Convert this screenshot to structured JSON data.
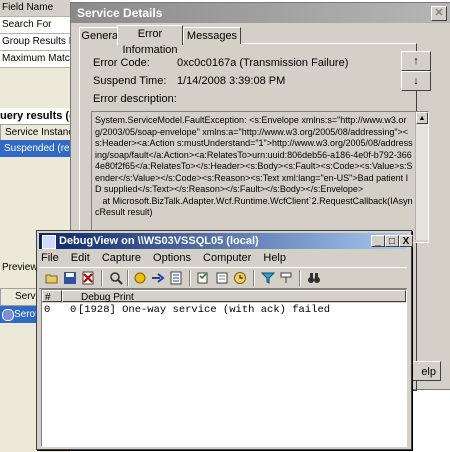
{
  "background_window": {
    "filter_grid": {
      "header": "Field Name",
      "rows": [
        "Search For",
        "Group Results By",
        "Maximum Matches"
      ]
    },
    "query_results_title": "uery results (one",
    "column_header": "Service Instance",
    "selected_row": "Suspended (resum",
    "preview_label": "Preview fo",
    "column_header_2": "Servic",
    "row_2": "Serote"
  },
  "service_details": {
    "title": "Service Details",
    "close_label": "✕",
    "tabs": [
      "General",
      "Error Information",
      "Messages"
    ],
    "active_tab": "Error Information",
    "fields": {
      "error_code_label": "Error Code:",
      "error_code_value": "0xc0c0167a (Transmission Failure)",
      "suspend_time_label": "Suspend Time:",
      "suspend_time_value": "1/14/2008 3:39:08 PM",
      "error_description_label": "Error description:"
    },
    "up_label": "↑",
    "down_label": "↓",
    "error_description": "System.ServiceModel.FaultException: <s:Envelope xmlns:s=\"http://www.w3.org/2003/05/soap-envelope\" xmlns:a=\"http://www.w3.org/2005/08/addressing\"><s:Header><a:Action s:mustUnderstand=\"1\">http://www.w3.org/2005/08/addressing/soap/fault</a:Action><a:RelatesTo>urn:uuid:806deb56-a186-4e0f-b792-3664e80f2f65</a:RelatesTo></s:Header><s:Body><s:Fault><s:Code><s:Value>s:Sender</s:Value></s:Code><s:Reason><s:Text xml:lang=\"en-US\">Bad patient ID supplied</s:Text></s:Reason></s:Fault></s:Body></s:Envelope>\n   at Microsoft.BizTalk.Adapter.Wcf.Runtime.WcfClient`2.RequestCallback(IAsyncResult result)",
    "help_label": "elp"
  },
  "debugview": {
    "title": "DebugView on \\\\WS03VSSQL05 (local)",
    "window_buttons": {
      "min": "_",
      "max": "□",
      "close": "X"
    },
    "menu": [
      "File",
      "Edit",
      "Capture",
      "Options",
      "Computer",
      "Help"
    ],
    "toolbar_icons": [
      "open-icon",
      "save-icon",
      "clear-icon",
      "find-icon",
      "capture-icon",
      "arrow-right-icon",
      "autoscroll-icon",
      "copy-icon",
      "filter-icon",
      "history-icon",
      "clock-icon",
      "highlight-icon",
      "properties-icon",
      "binoculars-icon"
    ],
    "columns": [
      "#",
      "Debug Print"
    ],
    "rows": [
      {
        "num": "0",
        "time": "0",
        "text": "[1928] One-way service (with ack) failed"
      }
    ]
  }
}
